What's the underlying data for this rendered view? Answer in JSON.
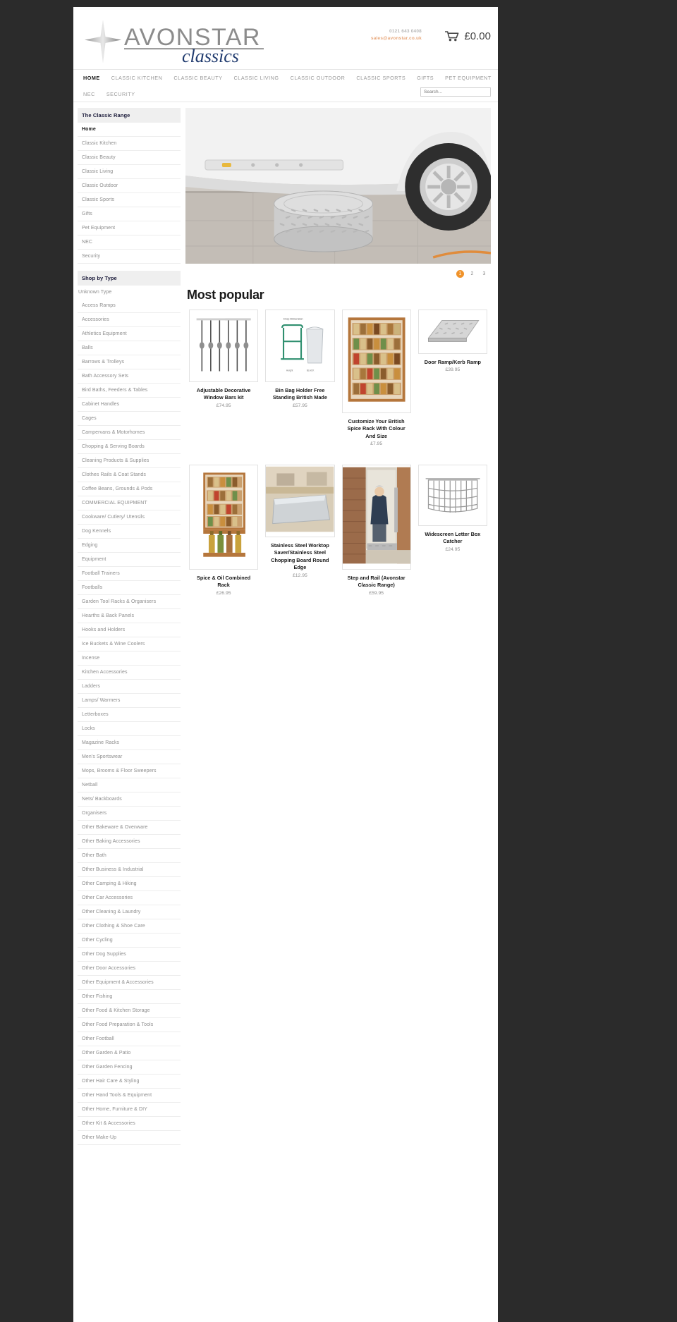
{
  "header": {
    "logo_main": "AVONSTAR",
    "logo_sub": "classics",
    "phone": "0121 643 0408",
    "email": "sales@avonstar.co.uk",
    "cart_total": "£0.00",
    "cart_icon": "shopping-cart-icon"
  },
  "nav": {
    "row1": [
      {
        "label": "HOME",
        "active": true
      },
      {
        "label": "CLASSIC KITCHEN",
        "active": false
      },
      {
        "label": "CLASSIC BEAUTY",
        "active": false
      },
      {
        "label": "CLASSIC LIVING",
        "active": false
      },
      {
        "label": "CLASSIC OUTDOOR",
        "active": false
      },
      {
        "label": "CLASSIC SPORTS",
        "active": false
      },
      {
        "label": "GIFTS",
        "active": false
      },
      {
        "label": "PET EQUIPMENT",
        "active": false
      }
    ],
    "row2": [
      {
        "label": "NEC",
        "active": false
      },
      {
        "label": "SECURITY",
        "active": false
      }
    ],
    "search_placeholder": "Search..."
  },
  "sidebar": {
    "classic_range_header": "The Classic Range",
    "classic_range": [
      "Home",
      "Classic Kitchen",
      "Classic Beauty",
      "Classic Living",
      "Classic Outdoor",
      "Classic Sports",
      "Gifts",
      "Pet Equipment",
      "NEC",
      "Security"
    ],
    "shop_by_type_header": "Shop by Type",
    "unknown_type": "Unknown Type",
    "types": [
      "Access Ramps",
      "Accessories",
      "Athletics Equipment",
      "Balls",
      "Barrows & Trolleys",
      "Bath Accessory Sets",
      "Bird Baths, Feeders & Tables",
      "Cabinet Handles",
      "Cages",
      "Campervans & Motorhomes",
      "Chopping & Serving Boards",
      "Cleaning Products & Supplies",
      "Clothes Rails & Coat Stands",
      "Coffee Beans, Grounds & Pods",
      "COMMERCIAL EQUIPMENT",
      "Cookware/ Cutlery/ Utensils",
      "Dog Kennels",
      "Edging",
      "Equipment",
      "Football Trainers",
      "Footballs",
      "Garden Tool Racks & Organisers",
      "Hearths & Back Panels",
      "Hooks and Holders",
      "Ice Buckets & Wine Coolers",
      "Incense",
      "Kitchen Accessories",
      "Ladders",
      "Lamps/ Warmers",
      "Letterboxes",
      "Locks",
      "Magazine Racks",
      "Men's Sportswear",
      "Mops, Brooms & Floor Sweepers",
      "Netball",
      "Nets/ Backboards",
      "Organisers",
      "Other Bakeware & Ovenware",
      "Other Baking Accessories",
      "Other Bath",
      "Other Business & Industrial",
      "Other Camping & Hiking",
      "Other Car Accessories",
      "Other Cleaning & Laundry",
      "Other Clothing & Shoe Care",
      "Other Cycling",
      "Other Dog Supplies",
      "Other Door Accessories",
      "Other Equipment & Accessories",
      "Other Fishing",
      "Other Food & Kitchen Storage",
      "Other Food Preparation & Tools",
      "Other Football",
      "Other Garden & Patio",
      "Other Garden Fencing",
      "Other Hair Care & Styling",
      "Other Hand Tools & Equipment",
      "Other Home, Furniture & DIY",
      "Other Kit & Accessories",
      "Other Make-Up"
    ]
  },
  "hero": {
    "alt": "aluminium-checker-plate-step-beside-vehicle"
  },
  "pagination": {
    "pages": [
      "1",
      "2",
      "3"
    ],
    "active": "1"
  },
  "main": {
    "section_title": "Most popular",
    "products": [
      {
        "title": "Adjustable Decorative Window Bars kit",
        "price": "£74.95",
        "image": "window-bars"
      },
      {
        "title": "Bin Bag Holder Free Standing British Made",
        "price": "£57.95",
        "image": "bin-bag-holder"
      },
      {
        "title": "Customize Your British Spice Rack With Colour And Size",
        "price": "£7.95",
        "image": "spice-rack"
      },
      {
        "title": "Door Ramp/Kerb Ramp",
        "price": "£39.95",
        "image": "door-ramp"
      },
      {
        "title": "Spice & Oil Combined Rack",
        "price": "£26.95",
        "image": "spice-oil-rack"
      },
      {
        "title": "Stainless Steel Worktop Saver/Stainless Steel Chopping Board Round Edge",
        "price": "£12.95",
        "image": "worktop-saver"
      },
      {
        "title": "Step and Rail (Avonstar Classic Range)",
        "price": "£59.95",
        "image": "step-and-rail"
      },
      {
        "title": "Widescreen Letter Box Catcher",
        "price": "£24.95",
        "image": "letter-box-catcher"
      }
    ]
  },
  "colors": {
    "accent_orange": "#f0932b",
    "logo_blue": "#1f3a6e",
    "email_orange": "#e8a87c"
  }
}
